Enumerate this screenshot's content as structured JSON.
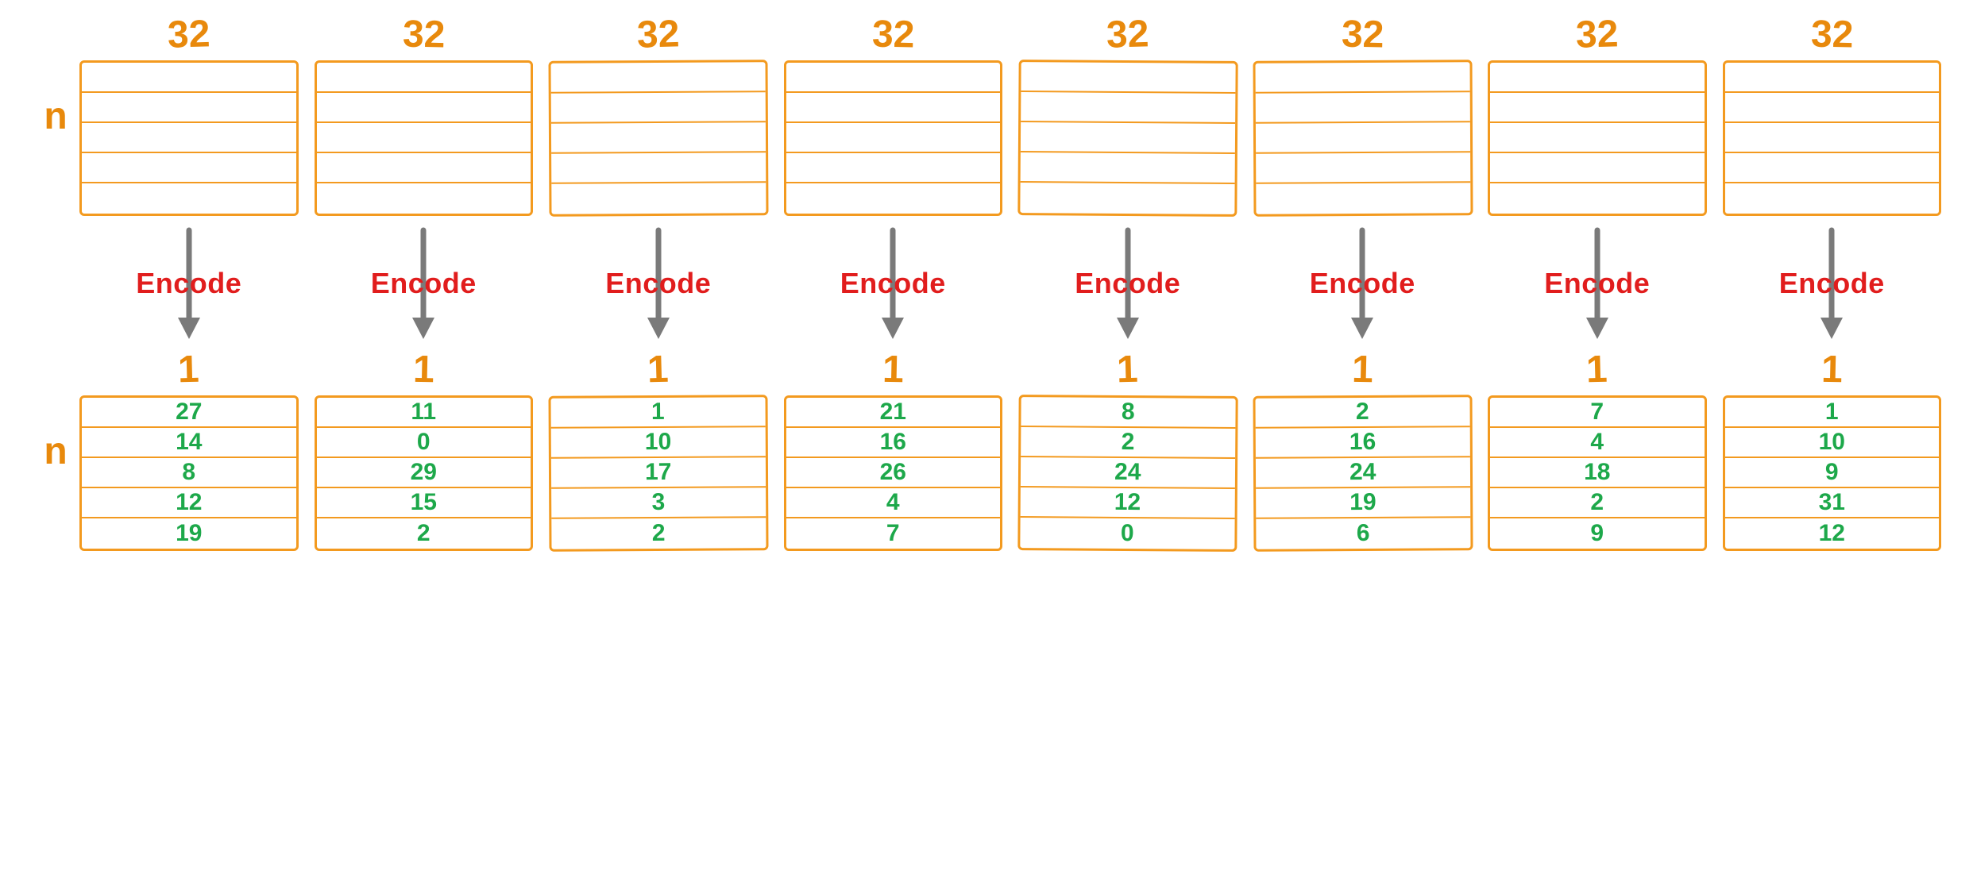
{
  "input_dim_label": "32",
  "output_dim_label": "1",
  "row_label": "n",
  "encode_label": "Encode",
  "num_rows": 5,
  "columns": [
    {
      "values": [
        "27",
        "14",
        "8",
        "12",
        "19"
      ]
    },
    {
      "values": [
        "11",
        "0",
        "29",
        "15",
        "2"
      ]
    },
    {
      "values": [
        "1",
        "10",
        "17",
        "3",
        "2"
      ]
    },
    {
      "values": [
        "21",
        "16",
        "26",
        "4",
        "7"
      ]
    },
    {
      "values": [
        "8",
        "2",
        "24",
        "12",
        "0"
      ]
    },
    {
      "values": [
        "2",
        "16",
        "24",
        "19",
        "6"
      ]
    },
    {
      "values": [
        "7",
        "4",
        "18",
        "2",
        "9"
      ]
    },
    {
      "values": [
        "1",
        "10",
        "9",
        "31",
        "12"
      ]
    }
  ],
  "colors": {
    "stroke": "#f39a1f",
    "label": "#e8890c",
    "arrow": "#7a7a7a",
    "encode": "#e11d1d",
    "value": "#1da84a"
  }
}
